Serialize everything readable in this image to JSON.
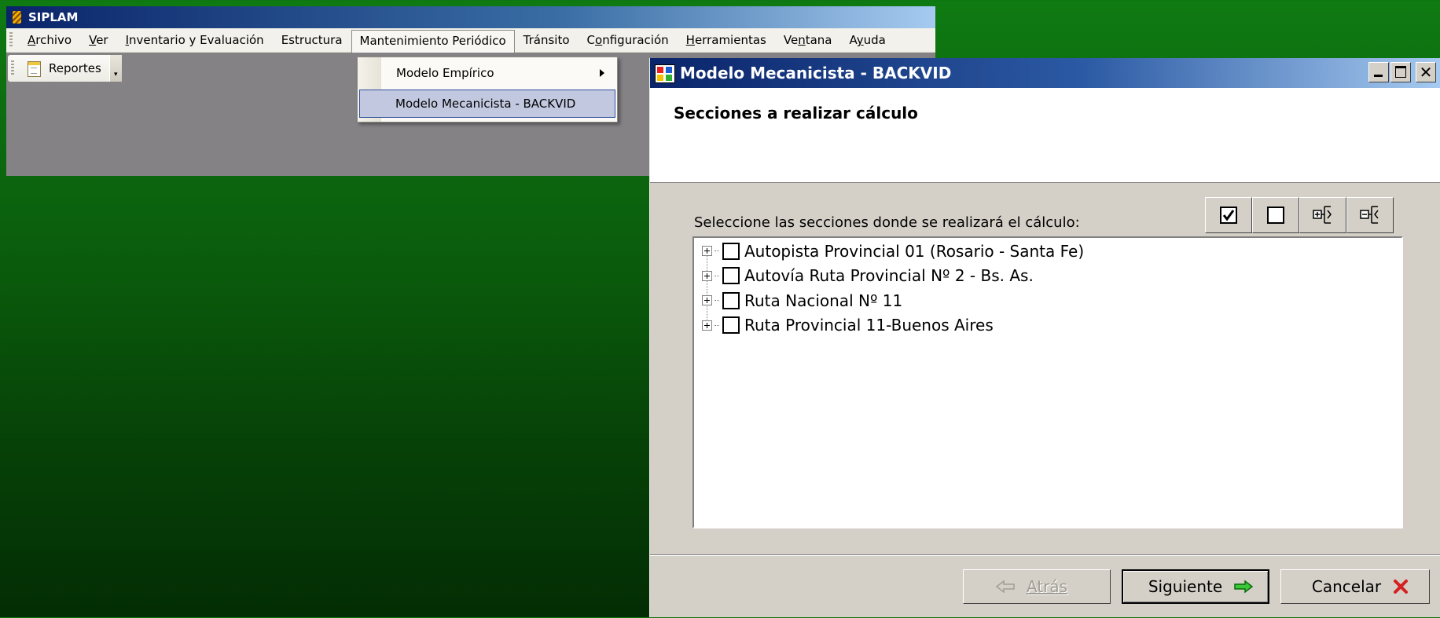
{
  "main_window": {
    "title": "SIPLAM",
    "menu": [
      "Archivo",
      "Ver",
      "Inventario y Evaluación",
      "Estructura",
      "Mantenimiento Periódico",
      "Tránsito",
      "Configuración",
      "Herramientas",
      "Ventana",
      "Ayuda"
    ],
    "open_menu_index": 4,
    "toolbar": {
      "reports_label": "Reportes"
    }
  },
  "dropdown": {
    "items": [
      {
        "label": "Modelo Empírico",
        "has_submenu": true
      },
      {
        "label": "Modelo Mecanicista - BACKVID",
        "highlighted": true
      }
    ]
  },
  "dialog": {
    "title": "Modelo Mecanicista - BACKVID",
    "header_title": "Secciones a realizar cálculo",
    "select_label": "Seleccione las secciones donde se realizará el cálculo:",
    "tool_buttons": [
      "check-all-icon",
      "uncheck-all-icon",
      "expand-all-icon",
      "collapse-all-icon"
    ],
    "tree_items": [
      {
        "label": "Autopista Provincial 01 (Rosario - Santa Fe)",
        "checked": false
      },
      {
        "label": "Autovía Ruta Provincial Nº 2 - Bs. As.",
        "checked": false
      },
      {
        "label": "Ruta Nacional Nº 11",
        "checked": false
      },
      {
        "label": "Ruta Provincial 11-Buenos Aires",
        "checked": false
      }
    ],
    "buttons": {
      "back": "Atrás",
      "next": "Siguiente",
      "cancel": "Cancelar"
    }
  },
  "colors": {
    "desktop_top": "#0f7a12",
    "desktop_bottom": "#032d04",
    "title_bar": "#0a246a",
    "menu_highlight": "#c1c8df"
  }
}
